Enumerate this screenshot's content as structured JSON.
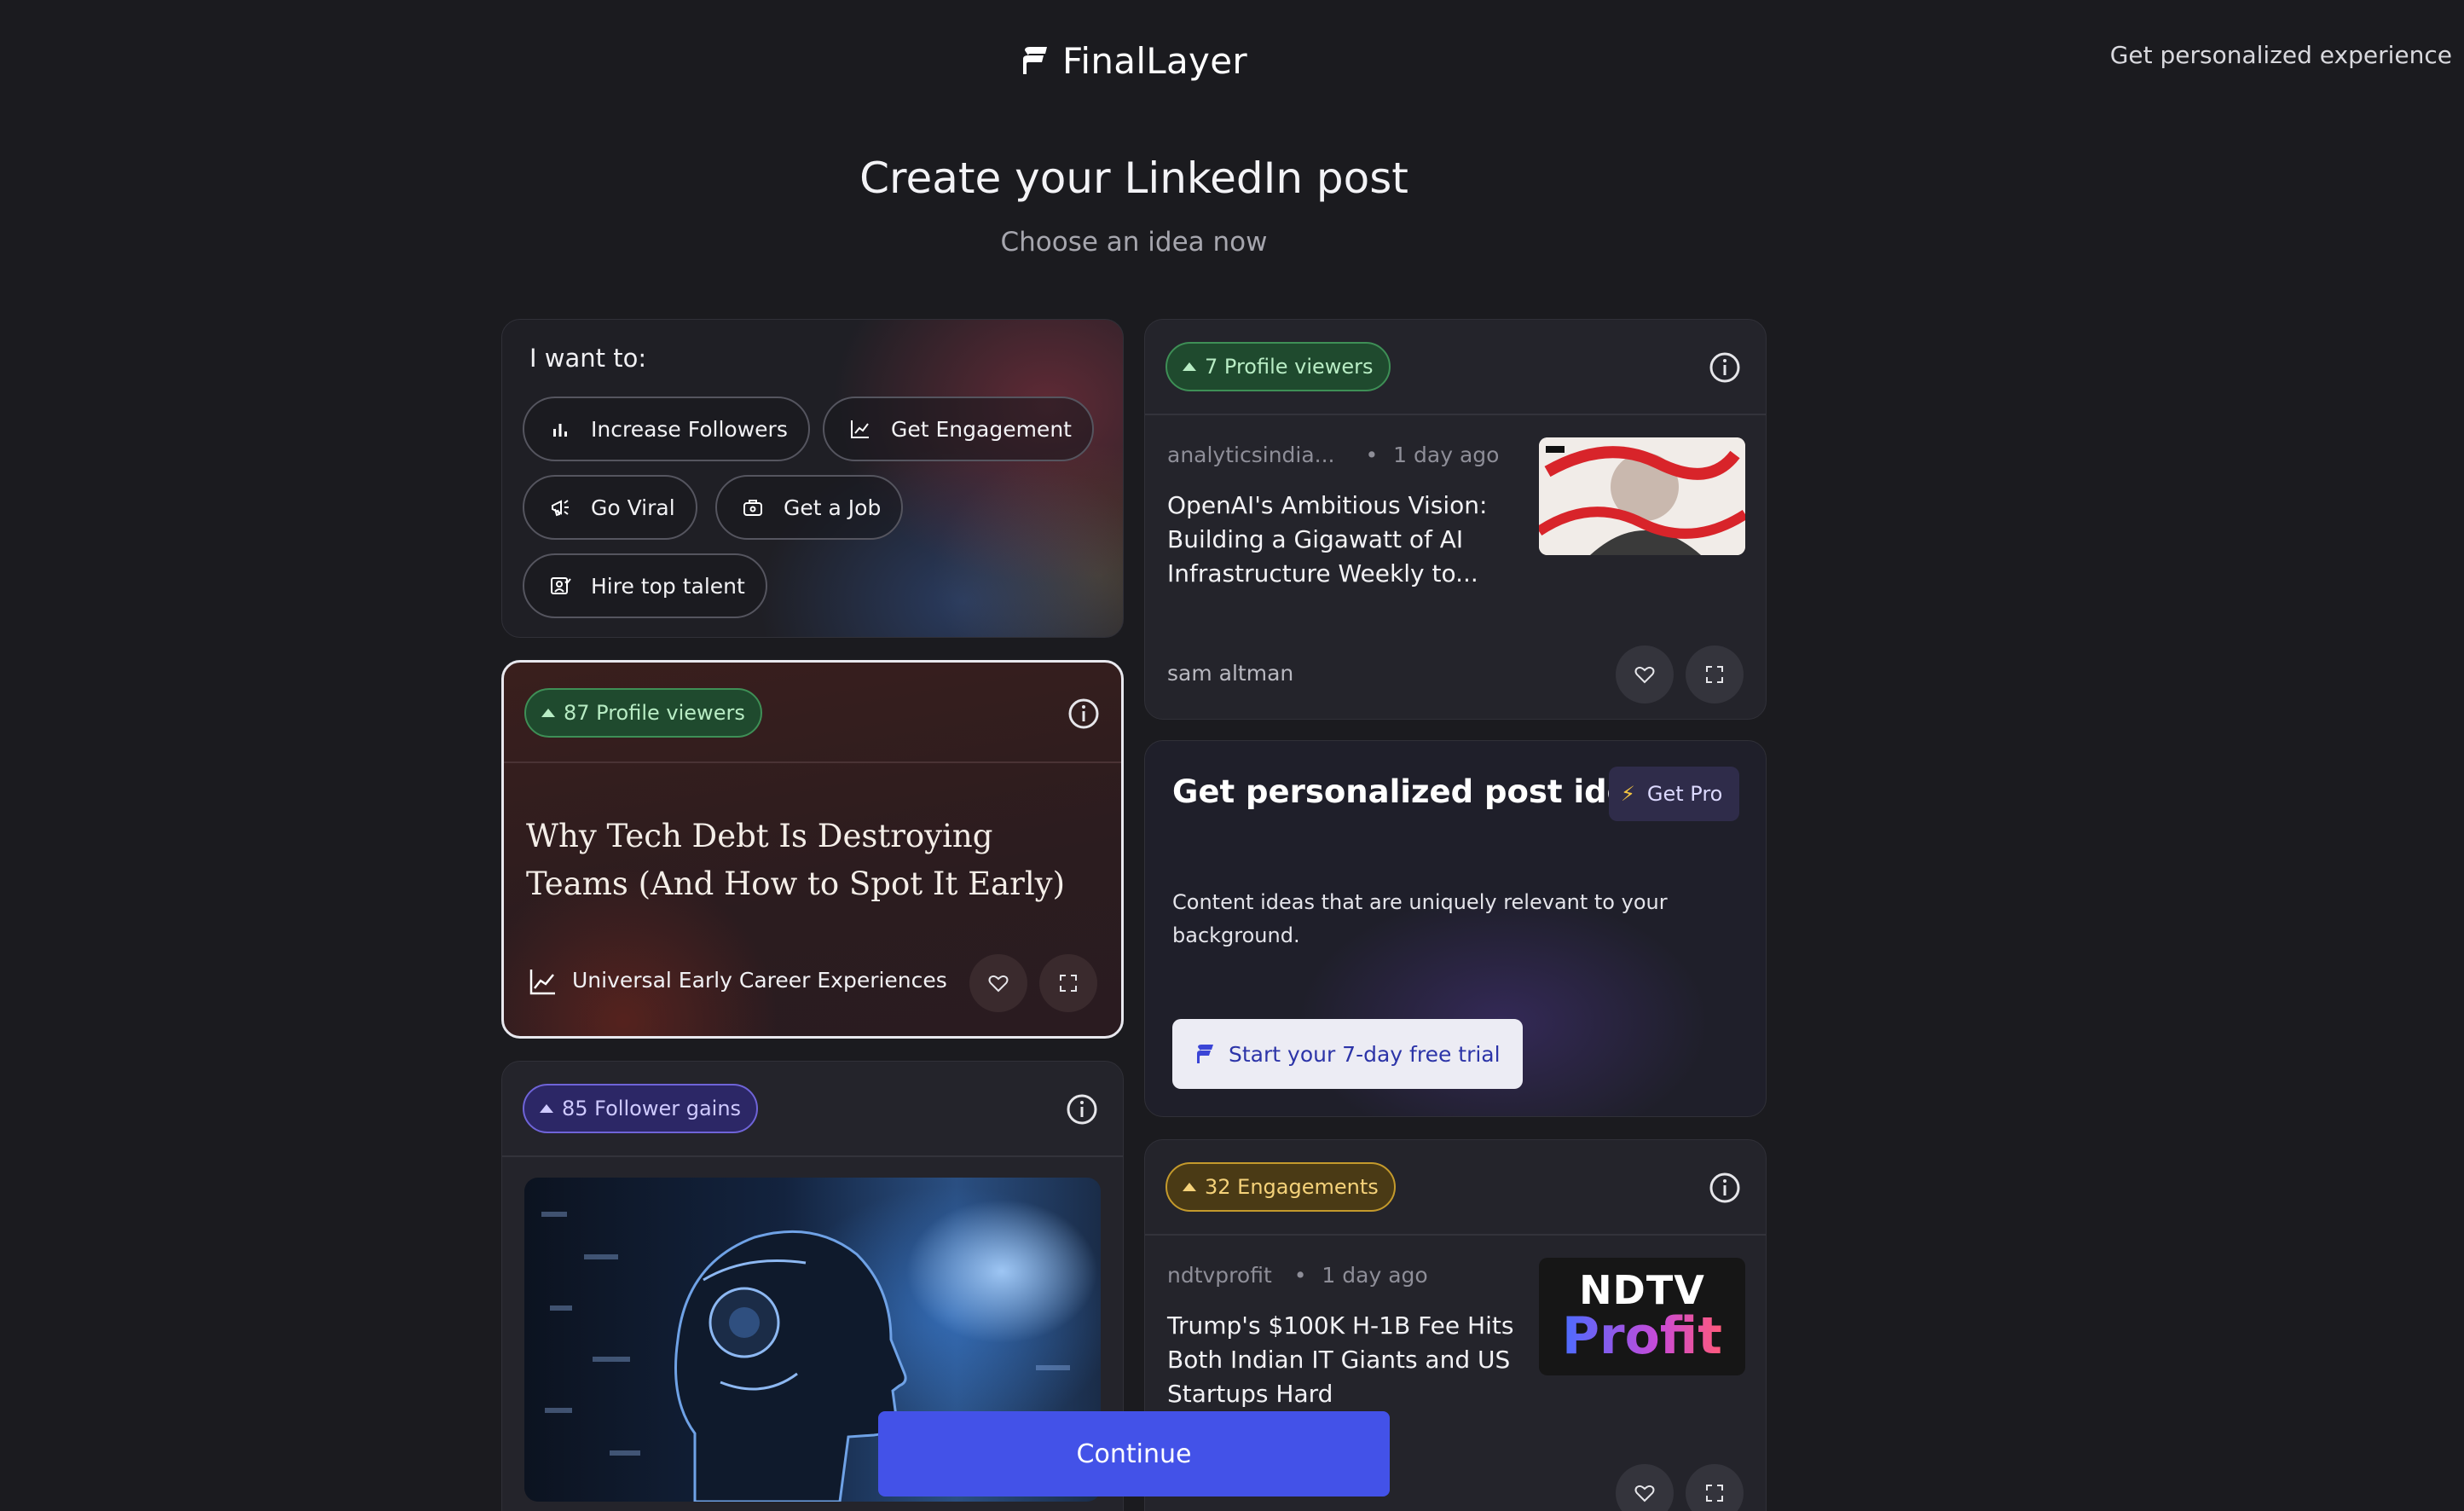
{
  "header": {
    "brand": "FinalLayer",
    "personalize_link": "Get personalized experience"
  },
  "hero": {
    "title": "Create your LinkedIn post",
    "subtitle": "Choose an idea now"
  },
  "goals": {
    "label": "I want to:",
    "chips": [
      {
        "label": "Increase Followers",
        "icon": "bar-chart-icon"
      },
      {
        "label": "Get Engagement",
        "icon": "line-chart-icon"
      },
      {
        "label": "Go Viral",
        "icon": "megaphone-icon"
      },
      {
        "label": "Get a Job",
        "icon": "briefcase-icon"
      },
      {
        "label": "Hire top talent",
        "icon": "hire-icon"
      }
    ]
  },
  "tech_card": {
    "badge": "87 Profile viewers",
    "title": "Why Tech Debt Is Destroying Teams (And How to Spot It Early)",
    "footer_label": "Universal Early Career Experiences"
  },
  "follower_card": {
    "badge": "85 Follower gains"
  },
  "openai_card": {
    "badge": "7 Profile viewers",
    "source": "analyticsindia...",
    "time": "1 day ago",
    "headline": "OpenAI's Ambitious Vision: Building a Gigawatt of AI Infrastructure Weekly to...",
    "author": "sam altman"
  },
  "promo": {
    "title": "Get personalized post ideas",
    "pro_label": "Get Pro",
    "description": "Content ideas that are uniquely relevant to your background.",
    "trial_label": "Start your 7-day free trial"
  },
  "ndtv_card": {
    "badge": "32 Engagements",
    "source": "ndtvprofit",
    "time": "1 day ago",
    "headline": "Trump's $100K H-1B Fee Hits Both Indian IT Giants and US Startups Hard",
    "thumb_top": "NDTV",
    "thumb_bottom": "Profit"
  },
  "continue_label": "Continue",
  "colors": {
    "background": "#1b1b1f",
    "accent": "#4352e8",
    "badge_green": "#3e8f56",
    "badge_purple": "#6f64d8",
    "badge_yellow": "#c49a2c"
  }
}
